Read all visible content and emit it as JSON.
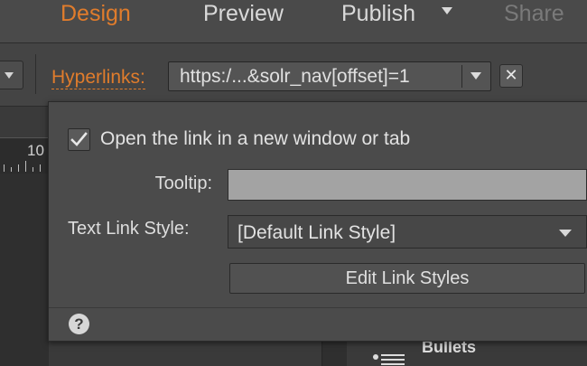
{
  "menu": {
    "design": "Design",
    "preview": "Preview",
    "publish": "Publish",
    "share": "Share"
  },
  "toolbar": {
    "hyperlinks_label": "Hyperlinks:",
    "url_value": "https:/...&solr_nav[offset]=1",
    "clear_glyph": "✕"
  },
  "ruler": {
    "number": "10"
  },
  "panel": {
    "new_window_label": "Open the link in a new window or tab",
    "new_window_checked": true,
    "tooltip_label": "Tooltip:",
    "tooltip_value": "",
    "link_style_label": "Text Link Style:",
    "link_style_value": "[Default Link Style]",
    "edit_styles_button": "Edit Link Styles",
    "help_glyph": "?"
  },
  "background": {
    "bullets_label": "Bullets"
  },
  "colors": {
    "accent": "#e07c2c",
    "panel_bg": "#4b4b4b",
    "tooltip_field": "#a3a3a3"
  }
}
